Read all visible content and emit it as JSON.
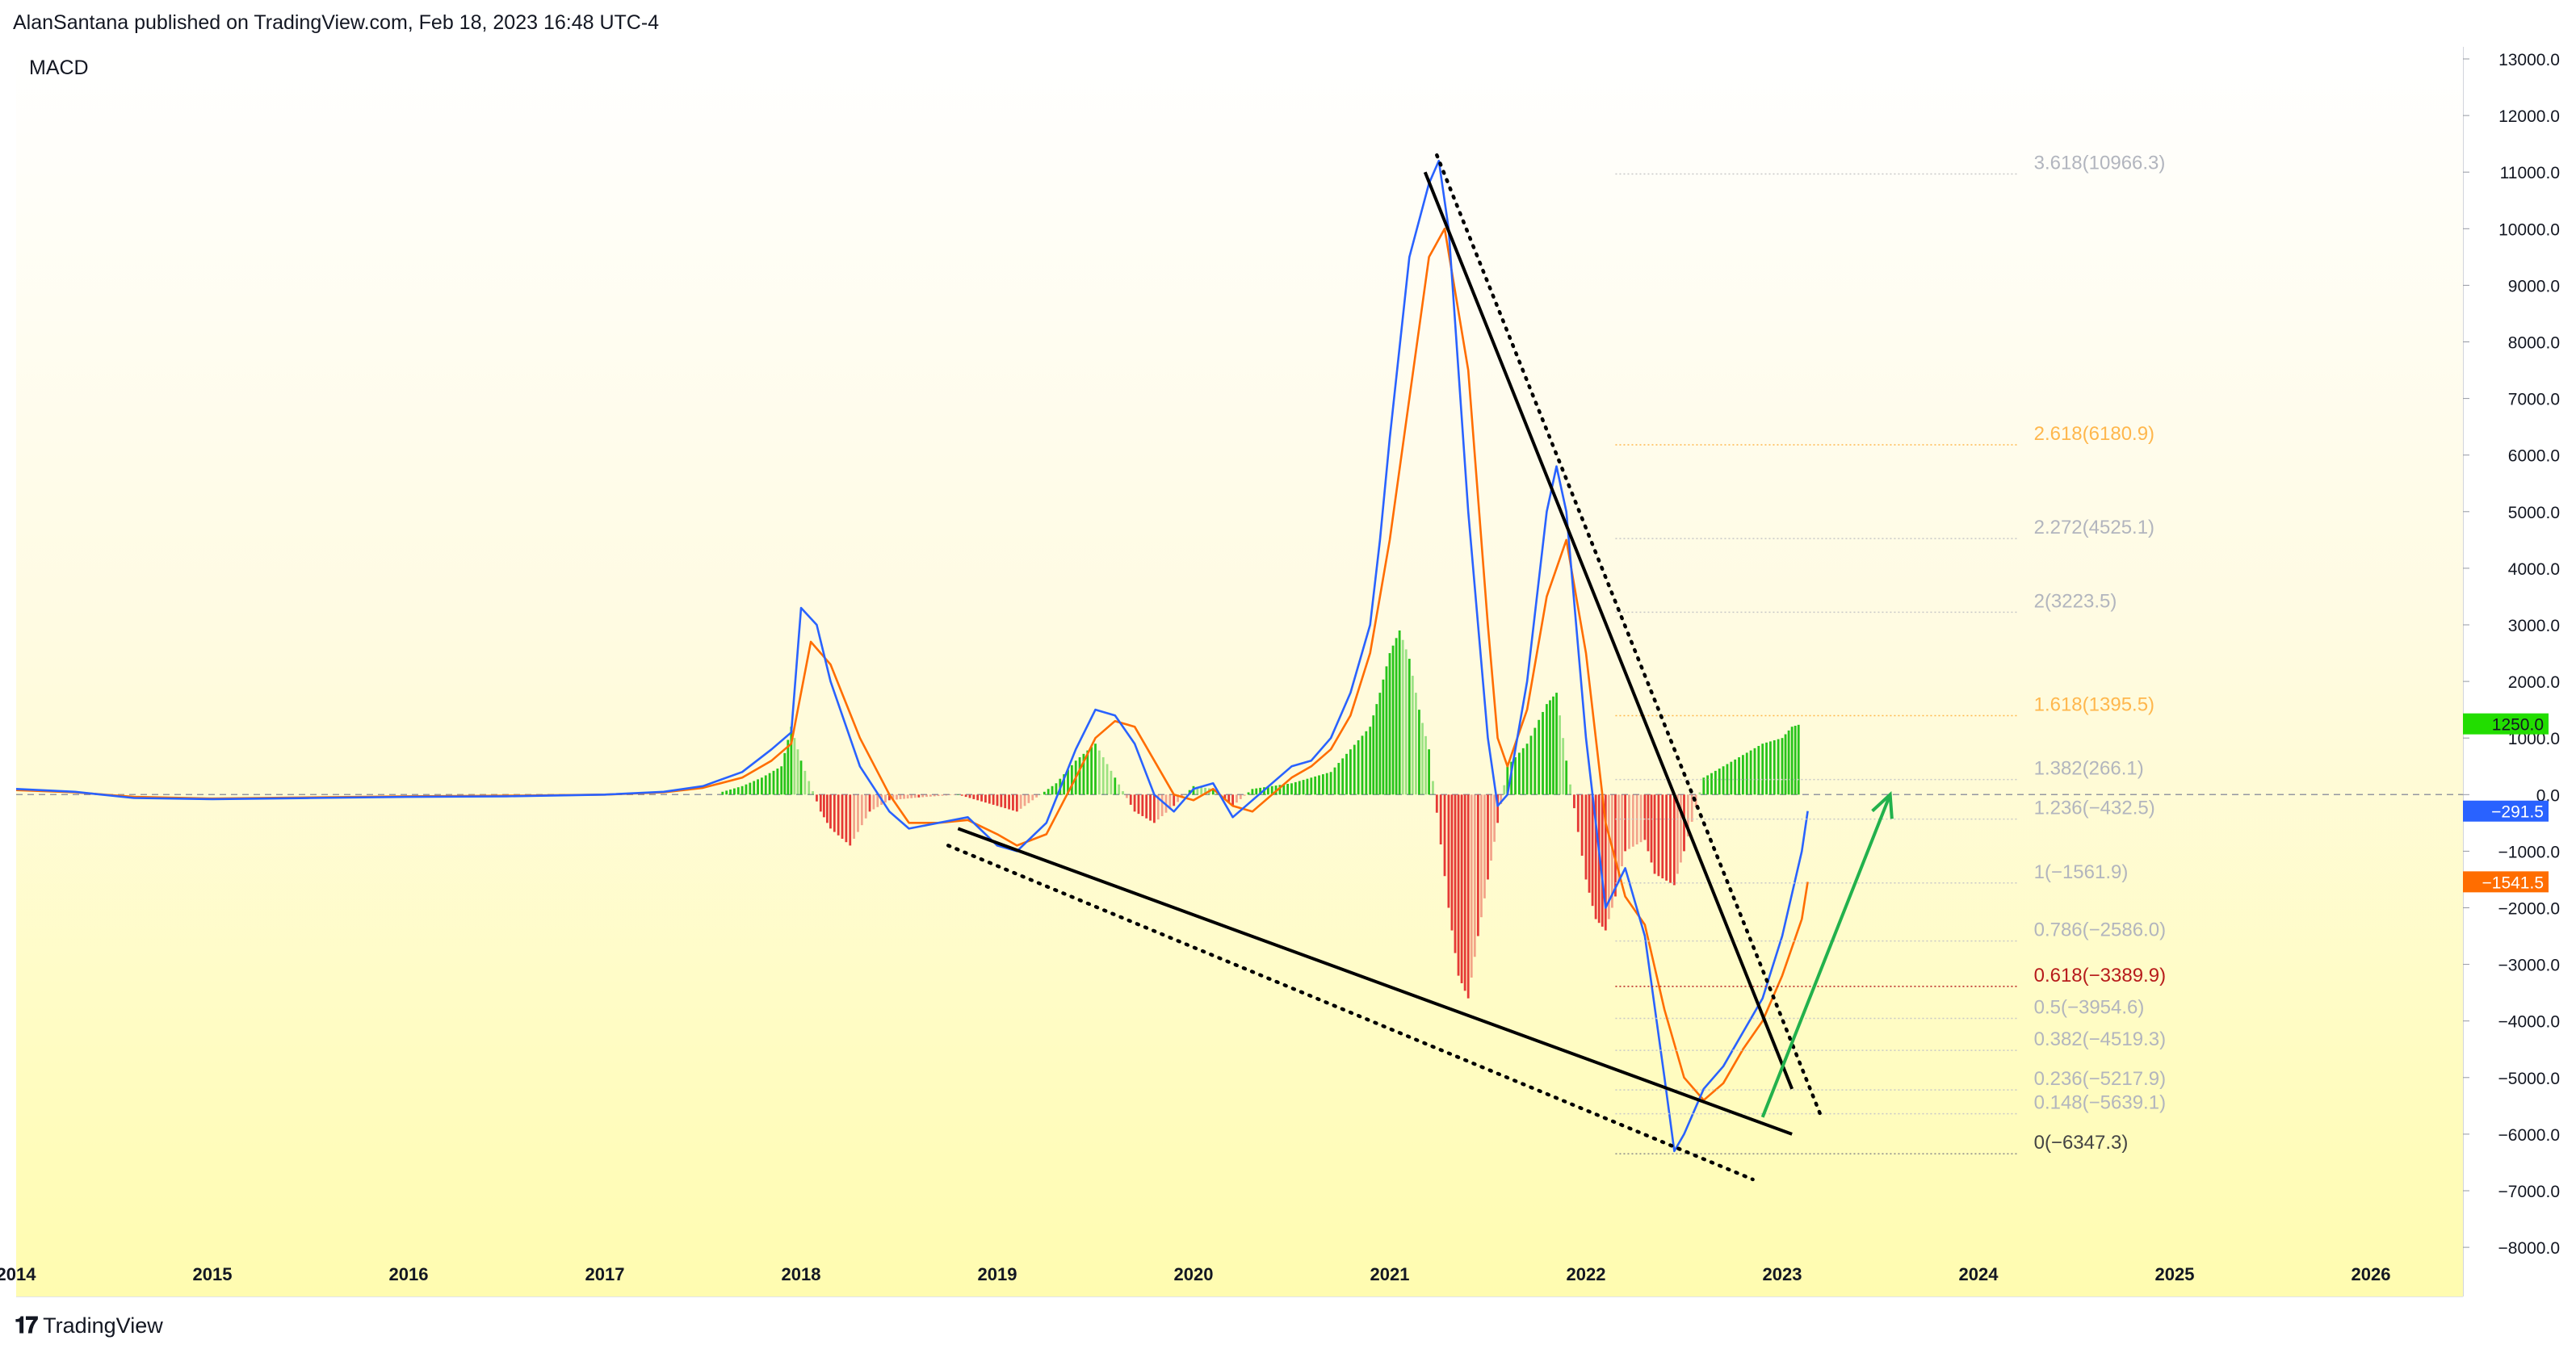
{
  "header": {
    "attribution": "AlanSantana published on TradingView.com, Feb 18, 2023 16:48 UTC-4"
  },
  "brand": {
    "logo_icon": "tradingview-logo-icon",
    "name": "TradingView"
  },
  "colors": {
    "macd_line": "#2962ff",
    "signal_line": "#ff6d00",
    "hist_positive": "#26c41a",
    "hist_negative": "#e53935",
    "trendline": "#000000",
    "arrow": "#22b14c",
    "fib_label": "#b2b5be",
    "fib_highlight_orange": "#ffb74d",
    "fib_highlight_red": "#b71c1c",
    "price_tag_green": "#22dd00",
    "price_tag_blue": "#2962ff",
    "price_tag_orange": "#ff6d00"
  },
  "chart_data": {
    "type": "line",
    "indicator": "MACD",
    "x_axis": {
      "labels": [
        "2014",
        "2015",
        "2016",
        "2017",
        "2018",
        "2019",
        "2020",
        "2021",
        "2022",
        "2023",
        "2024",
        "2025",
        "2026"
      ]
    },
    "y_axis": {
      "labels": [
        "13000.0",
        "12000.0",
        "11000.0",
        "10000.0",
        "9000.0",
        "8000.0",
        "7000.0",
        "6000.0",
        "5000.0",
        "4000.0",
        "3000.0",
        "2000.0",
        "1000.0",
        "0.0",
        "−1000.0",
        "−2000.0",
        "−3000.0",
        "−4000.0",
        "−5000.0",
        "−6000.0",
        "−7000.0",
        "−8000.0"
      ],
      "range": [
        -8000,
        13000
      ]
    },
    "series": [
      {
        "key": "macd",
        "points": [
          [
            2014.0,
            100
          ],
          [
            2014.3,
            50
          ],
          [
            2014.6,
            -60
          ],
          [
            2015.0,
            -80
          ],
          [
            2015.5,
            -60
          ],
          [
            2016.0,
            -40
          ],
          [
            2016.5,
            -30
          ],
          [
            2017.0,
            0
          ],
          [
            2017.3,
            50
          ],
          [
            2017.5,
            150
          ],
          [
            2017.7,
            400
          ],
          [
            2017.85,
            800
          ],
          [
            2017.95,
            1100
          ],
          [
            2018.0,
            3300
          ],
          [
            2018.08,
            3000
          ],
          [
            2018.15,
            2000
          ],
          [
            2018.3,
            500
          ],
          [
            2018.45,
            -300
          ],
          [
            2018.55,
            -600
          ],
          [
            2018.7,
            -500
          ],
          [
            2018.85,
            -400
          ],
          [
            2019.0,
            -900
          ],
          [
            2019.1,
            -1000
          ],
          [
            2019.25,
            -500
          ],
          [
            2019.4,
            800
          ],
          [
            2019.5,
            1500
          ],
          [
            2019.6,
            1400
          ],
          [
            2019.7,
            900
          ],
          [
            2019.8,
            0
          ],
          [
            2019.9,
            -300
          ],
          [
            2020.0,
            100
          ],
          [
            2020.1,
            200
          ],
          [
            2020.2,
            -400
          ],
          [
            2020.3,
            -100
          ],
          [
            2020.5,
            500
          ],
          [
            2020.6,
            600
          ],
          [
            2020.7,
            1000
          ],
          [
            2020.8,
            1800
          ],
          [
            2020.9,
            3000
          ],
          [
            2020.95,
            4500
          ],
          [
            2021.0,
            6300
          ],
          [
            2021.1,
            9500
          ],
          [
            2021.2,
            10800
          ],
          [
            2021.25,
            11200
          ],
          [
            2021.3,
            10000
          ],
          [
            2021.4,
            5000
          ],
          [
            2021.5,
            1000
          ],
          [
            2021.55,
            -200
          ],
          [
            2021.6,
            0
          ],
          [
            2021.7,
            2000
          ],
          [
            2021.8,
            5000
          ],
          [
            2021.85,
            5800
          ],
          [
            2021.9,
            5000
          ],
          [
            2022.0,
            1000
          ],
          [
            2022.1,
            -2000
          ],
          [
            2022.2,
            -1300
          ],
          [
            2022.3,
            -2500
          ],
          [
            2022.4,
            -5000
          ],
          [
            2022.45,
            -6300
          ],
          [
            2022.5,
            -6000
          ],
          [
            2022.6,
            -5200
          ],
          [
            2022.7,
            -4800
          ],
          [
            2022.8,
            -4200
          ],
          [
            2022.9,
            -3600
          ],
          [
            2023.0,
            -2500
          ],
          [
            2023.1,
            -1000
          ],
          [
            2023.13,
            -291.5
          ]
        ]
      },
      {
        "key": "signal",
        "points": [
          [
            2014.0,
            80
          ],
          [
            2014.3,
            40
          ],
          [
            2014.6,
            -40
          ],
          [
            2015.0,
            -70
          ],
          [
            2015.5,
            -50
          ],
          [
            2016.0,
            -30
          ],
          [
            2016.5,
            -20
          ],
          [
            2017.0,
            0
          ],
          [
            2017.3,
            40
          ],
          [
            2017.5,
            120
          ],
          [
            2017.7,
            300
          ],
          [
            2017.85,
            600
          ],
          [
            2017.95,
            900
          ],
          [
            2018.05,
            2700
          ],
          [
            2018.15,
            2300
          ],
          [
            2018.3,
            1000
          ],
          [
            2018.45,
            0
          ],
          [
            2018.55,
            -500
          ],
          [
            2018.7,
            -500
          ],
          [
            2018.85,
            -450
          ],
          [
            2019.0,
            -700
          ],
          [
            2019.1,
            -900
          ],
          [
            2019.25,
            -700
          ],
          [
            2019.4,
            300
          ],
          [
            2019.5,
            1000
          ],
          [
            2019.6,
            1300
          ],
          [
            2019.7,
            1200
          ],
          [
            2019.8,
            600
          ],
          [
            2019.9,
            0
          ],
          [
            2020.0,
            -100
          ],
          [
            2020.1,
            100
          ],
          [
            2020.2,
            -200
          ],
          [
            2020.3,
            -300
          ],
          [
            2020.5,
            300
          ],
          [
            2020.6,
            500
          ],
          [
            2020.7,
            800
          ],
          [
            2020.8,
            1400
          ],
          [
            2020.9,
            2500
          ],
          [
            2020.95,
            3500
          ],
          [
            2021.0,
            4500
          ],
          [
            2021.1,
            7000
          ],
          [
            2021.2,
            9500
          ],
          [
            2021.28,
            10000
          ],
          [
            2021.4,
            7500
          ],
          [
            2021.5,
            3000
          ],
          [
            2021.55,
            1000
          ],
          [
            2021.6,
            500
          ],
          [
            2021.7,
            1500
          ],
          [
            2021.8,
            3500
          ],
          [
            2021.9,
            4500
          ],
          [
            2022.0,
            2500
          ],
          [
            2022.1,
            -500
          ],
          [
            2022.2,
            -1800
          ],
          [
            2022.3,
            -2300
          ],
          [
            2022.4,
            -3800
          ],
          [
            2022.5,
            -5000
          ],
          [
            2022.6,
            -5400
          ],
          [
            2022.7,
            -5100
          ],
          [
            2022.8,
            -4500
          ],
          [
            2022.9,
            -4000
          ],
          [
            2023.0,
            -3200
          ],
          [
            2023.1,
            -2200
          ],
          [
            2023.13,
            -1541.5
          ]
        ]
      },
      {
        "key": "histogram",
        "points": [
          [
            2017.6,
            50
          ],
          [
            2017.7,
            150
          ],
          [
            2017.8,
            300
          ],
          [
            2017.9,
            500
          ],
          [
            2017.95,
            1200
          ],
          [
            2018.0,
            600
          ],
          [
            2018.1,
            -300
          ],
          [
            2018.15,
            -600
          ],
          [
            2018.25,
            -900
          ],
          [
            2018.35,
            -300
          ],
          [
            2018.45,
            -100
          ],
          [
            2018.6,
            -50
          ],
          [
            2018.8,
            0
          ],
          [
            2019.0,
            -200
          ],
          [
            2019.1,
            -300
          ],
          [
            2019.3,
            200
          ],
          [
            2019.4,
            600
          ],
          [
            2019.5,
            900
          ],
          [
            2019.6,
            300
          ],
          [
            2019.7,
            -300
          ],
          [
            2019.8,
            -500
          ],
          [
            2019.9,
            -200
          ],
          [
            2020.0,
            150
          ],
          [
            2020.1,
            100
          ],
          [
            2020.2,
            -200
          ],
          [
            2020.3,
            100
          ],
          [
            2020.5,
            200
          ],
          [
            2020.6,
            300
          ],
          [
            2020.7,
            400
          ],
          [
            2020.8,
            800
          ],
          [
            2020.9,
            1200
          ],
          [
            2020.95,
            1800
          ],
          [
            2021.0,
            2500
          ],
          [
            2021.05,
            2900
          ],
          [
            2021.1,
            2400
          ],
          [
            2021.15,
            1500
          ],
          [
            2021.2,
            800
          ],
          [
            2021.3,
            -2000
          ],
          [
            2021.35,
            -3200
          ],
          [
            2021.4,
            -3600
          ],
          [
            2021.45,
            -2500
          ],
          [
            2021.5,
            -1500
          ],
          [
            2021.55,
            -500
          ],
          [
            2021.6,
            500
          ],
          [
            2021.7,
            900
          ],
          [
            2021.8,
            1600
          ],
          [
            2021.85,
            1800
          ],
          [
            2021.9,
            600
          ],
          [
            2022.0,
            -1500
          ],
          [
            2022.05,
            -2200
          ],
          [
            2022.1,
            -2400
          ],
          [
            2022.15,
            -1800
          ],
          [
            2022.2,
            -1000
          ],
          [
            2022.3,
            -800
          ],
          [
            2022.35,
            -1400
          ],
          [
            2022.45,
            -1600
          ],
          [
            2022.5,
            -1000
          ],
          [
            2022.6,
            300
          ],
          [
            2022.7,
            500
          ],
          [
            2022.8,
            700
          ],
          [
            2022.9,
            900
          ],
          [
            2023.0,
            1000
          ],
          [
            2023.05,
            1200
          ],
          [
            2023.1,
            1250
          ]
        ]
      }
    ],
    "price_tags": [
      {
        "value": 1250,
        "label": "1250.0",
        "color_key": "price_tag_green"
      },
      {
        "value": -291.5,
        "label": "−291.5",
        "color_key": "price_tag_blue"
      },
      {
        "value": -1541.5,
        "label": "−1541.5",
        "color_key": "price_tag_orange"
      }
    ],
    "fibonacci": {
      "x_start": 2022.15,
      "x_end": 2024.2,
      "levels": [
        {
          "value": 10966.3,
          "label": "3.618(10966.3)",
          "style": "normal"
        },
        {
          "value": 6180.9,
          "label": "2.618(6180.9)",
          "style": "orange"
        },
        {
          "value": 4525.1,
          "label": "2.272(4525.1)",
          "style": "normal"
        },
        {
          "value": 3223.5,
          "label": "2(3223.5)",
          "style": "normal"
        },
        {
          "value": 1395.5,
          "label": "1.618(1395.5)",
          "style": "orange"
        },
        {
          "value": 266.1,
          "label": "1.382(266.1)",
          "style": "normal"
        },
        {
          "value": -432.5,
          "label": "1.236(−432.5)",
          "style": "normal"
        },
        {
          "value": -1561.9,
          "label": "1(−1561.9)",
          "style": "normal"
        },
        {
          "value": -2586.0,
          "label": "0.786(−2586.0)",
          "style": "normal"
        },
        {
          "value": -3389.9,
          "label": "0.618(−3389.9)",
          "style": "red"
        },
        {
          "value": -3954.6,
          "label": "0.5(−3954.6)",
          "style": "normal"
        },
        {
          "value": -4519.3,
          "label": "0.382(−4519.3)",
          "style": "normal"
        },
        {
          "value": -5217.9,
          "label": "0.236(−5217.9)",
          "style": "normal"
        },
        {
          "value": -5639.1,
          "label": "0.148(−5639.1)",
          "style": "normal"
        },
        {
          "value": -6347.3,
          "label": "0(−6347.3)",
          "style": "dark"
        }
      ]
    },
    "drawings": [
      {
        "kind": "solid",
        "from": [
          2021.18,
          11000
        ],
        "to": [
          2023.05,
          -5200
        ]
      },
      {
        "kind": "dotted",
        "from": [
          2021.24,
          11300
        ],
        "to": [
          2023.2,
          -5700
        ]
      },
      {
        "kind": "solid",
        "from": [
          2018.8,
          -600
        ],
        "to": [
          2023.05,
          -6000
        ]
      },
      {
        "kind": "dotted",
        "from": [
          2018.75,
          -900
        ],
        "to": [
          2022.85,
          -6800
        ]
      },
      {
        "kind": "arrow",
        "from": [
          2022.9,
          -5700
        ],
        "to": [
          2023.55,
          0
        ]
      }
    ]
  }
}
